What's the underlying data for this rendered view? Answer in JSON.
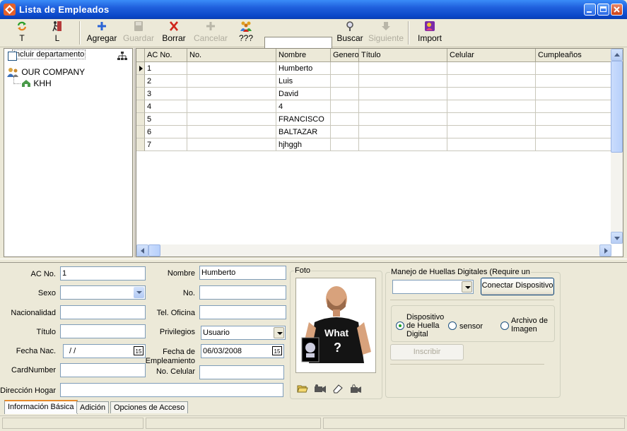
{
  "window": {
    "title": "Lista de Empleados"
  },
  "toolbar": {
    "refresh": "T",
    "logout": "L",
    "add": "Agregar",
    "save": "Guardar",
    "delete": "Borrar",
    "cancel": "Cancelar",
    "unknown": "???",
    "search": "Buscar",
    "next": "Siguiente",
    "import": "Import",
    "search_value": ""
  },
  "tree": {
    "include_dept_label": "Incluir departamento",
    "nodes": [
      "OUR COMPANY",
      "KHH"
    ]
  },
  "grid": {
    "columns": [
      "AC No.",
      "No.",
      "Nombre",
      "Genero",
      "Título",
      "Celular",
      "Cumpleaños"
    ],
    "rows": [
      [
        "1",
        "",
        "Humberto",
        "",
        "",
        "",
        ""
      ],
      [
        "2",
        "",
        "Luis",
        "",
        "",
        "",
        ""
      ],
      [
        "3",
        "",
        "David",
        "",
        "",
        "",
        ""
      ],
      [
        "4",
        "",
        "4",
        "",
        "",
        "",
        ""
      ],
      [
        "5",
        "",
        "FRANCISCO",
        "",
        "",
        "",
        ""
      ],
      [
        "6",
        "",
        "BALTAZAR",
        "",
        "",
        "",
        ""
      ],
      [
        "7",
        "",
        "hjhggh",
        "",
        "",
        "",
        ""
      ]
    ]
  },
  "form": {
    "ac_no_label": "AC No.",
    "ac_no_value": "1",
    "sexo_label": "Sexo",
    "sexo_value": "",
    "nacionalidad_label": "Nacionalidad",
    "nacionalidad_value": "",
    "titulo_label": "Título",
    "titulo_value": "",
    "fecha_nac_label": "Fecha Nac.",
    "fecha_nac_value": "/ /",
    "cardnumber_label": "CardNumber",
    "cardnumber_value": "",
    "direccion_label": "Dirección Hogar",
    "direccion_value": "",
    "nombre_label": "Nombre",
    "nombre_value": "Humberto",
    "no_label": "No.",
    "no_value": "",
    "tel_label": "Tel. Oficina",
    "tel_value": "",
    "privilegios_label": "Privilegios",
    "privilegios_value": "Usuario",
    "fecha_emp_label_1": "Fecha de",
    "fecha_emp_label_2": "Empleamiento",
    "fecha_emp_value": "06/03/2008",
    "celular_label": "No. Celular",
    "celular_value": "",
    "cal_glyph": "15",
    "foto_label": "Foto",
    "photo_shirt_line1": "What",
    "photo_shirt_line2": "?"
  },
  "fingerprint": {
    "title": "Manejo de Huellas Digitales (Require un",
    "device_value": "",
    "connect_button": "Conectar Dispositivo",
    "radio_device": "Dispositivo de Huella Digital",
    "radio_sensor": "sensor",
    "radio_file": "Archivo de Imagen",
    "enroll_button": "Inscribir"
  },
  "tabs": [
    "Información Básica",
    "Adición",
    "Opciones de Acceso"
  ],
  "colors": {
    "title_bar": "#0a47c8",
    "window_bg": "#ece9d8",
    "tab_accent": "#e68b2c",
    "delete_red": "#d0261b",
    "add_blue": "#2a64d6"
  }
}
